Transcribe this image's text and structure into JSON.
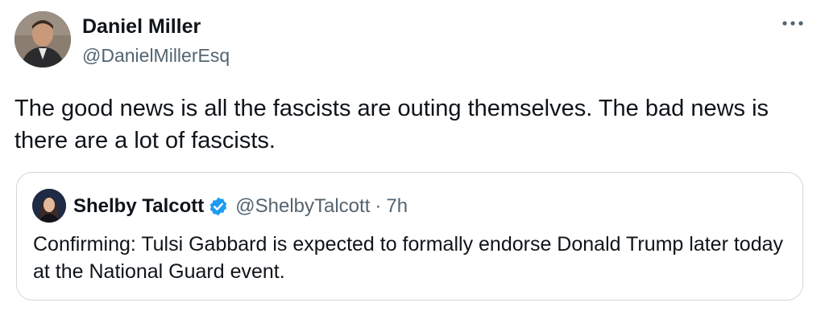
{
  "tweet": {
    "author": {
      "name": "Daniel Miller",
      "handle": "@DanielMillerEsq"
    },
    "text": "The good news is all the fascists are outing themselves. The bad news is there are a lot of fascists.",
    "more_icon": "ellipsis-icon"
  },
  "quote": {
    "author": {
      "name": "Shelby Talcott",
      "handle": "@ShelbyTalcott",
      "verified": true
    },
    "separator": "·",
    "time": "7h",
    "text": "Confirming: Tulsi Gabbard is expected to formally endorse Donald Trump later today at the National Guard event."
  },
  "colors": {
    "text": "#0f1419",
    "secondary": "#536471",
    "verified_badge": "#1d9bf0",
    "border": "#cfd9de"
  }
}
